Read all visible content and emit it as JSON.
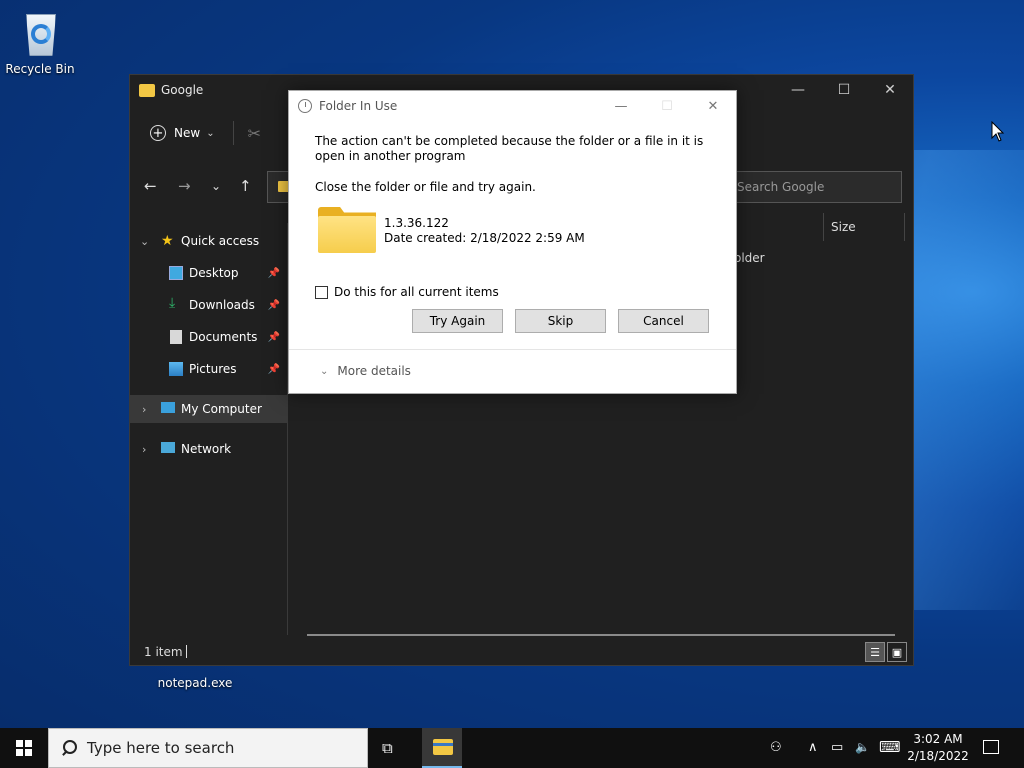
{
  "desktop": {
    "icons": [
      {
        "label": "Recycle Bin",
        "icon": "recycle-bin-icon"
      },
      {
        "label": "notepad.exe",
        "icon": "notepad-icon"
      }
    ]
  },
  "explorer": {
    "title": "Google",
    "controls": {
      "minimize": "—",
      "maximize": "☐",
      "close": "✕"
    },
    "toolbar": {
      "new_label": "New",
      "new_chevron": "⌄",
      "cut_icon": "✂"
    },
    "nav": {
      "back": "←",
      "forward": "→",
      "recent": "⌄",
      "up": "↑"
    },
    "search_placeholder": "Search Google",
    "column_header": "Size",
    "visible_item_type": "older",
    "nav_pane": {
      "quick_access": "Quick access",
      "items": [
        {
          "label": "Desktop",
          "pin": "📌"
        },
        {
          "label": "Downloads",
          "pin": "📌"
        },
        {
          "label": "Documents",
          "pin": "📌"
        },
        {
          "label": "Pictures",
          "pin": "📌"
        }
      ],
      "my_computer": "My Computer",
      "network": "Network"
    },
    "status": {
      "count": "1 item"
    },
    "views": {
      "details": "☰",
      "large": "▣"
    }
  },
  "dialog": {
    "title": "Folder In Use",
    "controls": {
      "minimize": "—",
      "maximize": "☐",
      "close": "✕"
    },
    "message": "The action can't be completed because the folder or a file in it is open in another program",
    "instruction": "Close the folder or file and try again.",
    "file_name": "1.3.36.122",
    "file_date": "Date created: 2/18/2022 2:59 AM",
    "checkbox_label": "Do this for all current items",
    "buttons": {
      "try_again": "Try Again",
      "skip": "Skip",
      "cancel": "Cancel"
    },
    "more_details": "More details",
    "more_chevron": "⌄"
  },
  "taskbar": {
    "search_placeholder": "Type here to search",
    "taskview_icon": "⧉",
    "tray": {
      "people": "⚇",
      "chevron": "∧",
      "network": "▭",
      "volume": "🔈",
      "keyboard": "⌨"
    },
    "time": "3:02 AM",
    "date": "2/18/2022"
  }
}
